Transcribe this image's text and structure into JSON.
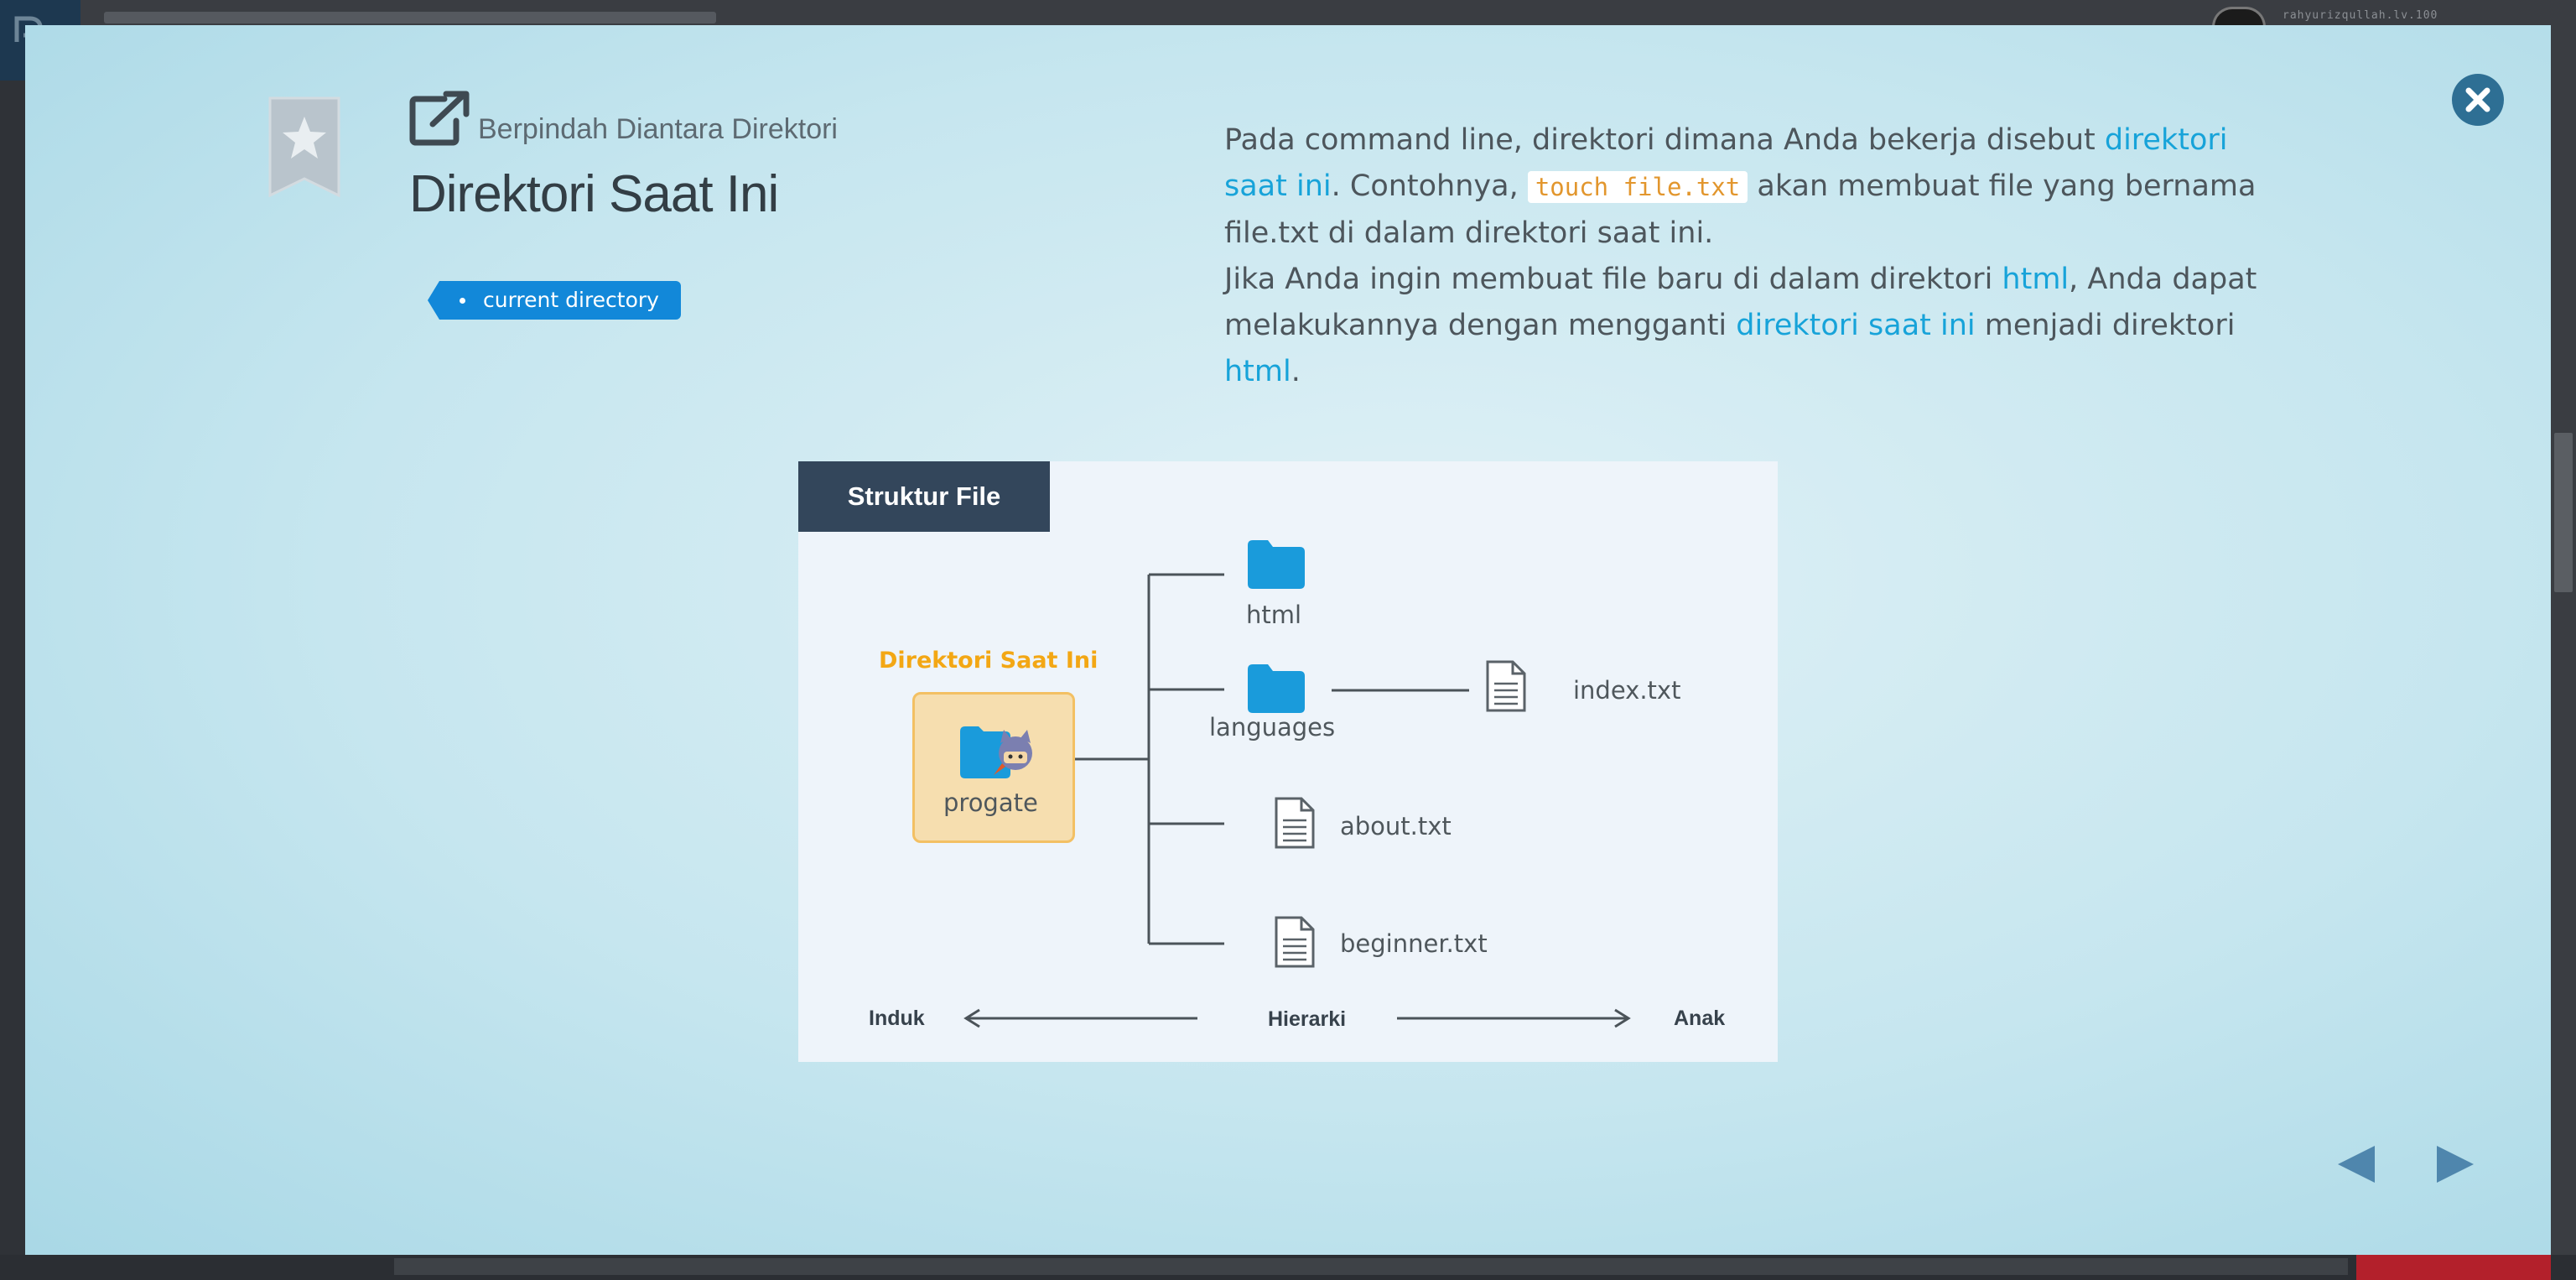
{
  "background": {
    "username": "rahyurizqullah.lv.100"
  },
  "modal": {
    "bookmark_icon": "star-bookmark-icon",
    "section_icon": "external-link-icon",
    "section_title": "Berpindah Diantara Direktori",
    "page_title": "Direktori Saat Ini",
    "tag": "current directory",
    "close_icon": "close-circle-icon",
    "description": {
      "p1_a": "Pada command line, direktori dimana Anda bekerja disebut ",
      "p1_hl": "direktori saat ini",
      "p1_b": ". Contohnya, ",
      "p1_code": "touch file.txt",
      "p1_c": " akan membuat file yang bernama file.txt di dalam direktori saat ini.",
      "p2_a": "Jika Anda ingin membuat file baru di dalam direktori ",
      "p2_hl1": "html",
      "p2_b": ", Anda dapat melakukannya dengan mengganti ",
      "p2_hl2": "direktori saat ini",
      "p2_c": " menjadi direktori ",
      "p2_hl3": "html",
      "p2_d": "."
    },
    "diagram": {
      "header": "Struktur File",
      "current_label": "Direktori Saat Ini",
      "root": "progate",
      "folders": [
        "html",
        "languages"
      ],
      "files": [
        "index.txt",
        "about.txt",
        "beginner.txt"
      ],
      "axis_left": "Induk",
      "axis_middle": "Hierarki",
      "axis_right": "Anak"
    },
    "nav": {
      "prev_icon": "triangle-left-icon",
      "next_icon": "triangle-right-icon"
    },
    "colors": {
      "accent": "#17a3d9",
      "tag": "#1288d9",
      "code": "#e2962d",
      "current_dir": "#f3a714",
      "close": "#2e6f94"
    }
  }
}
